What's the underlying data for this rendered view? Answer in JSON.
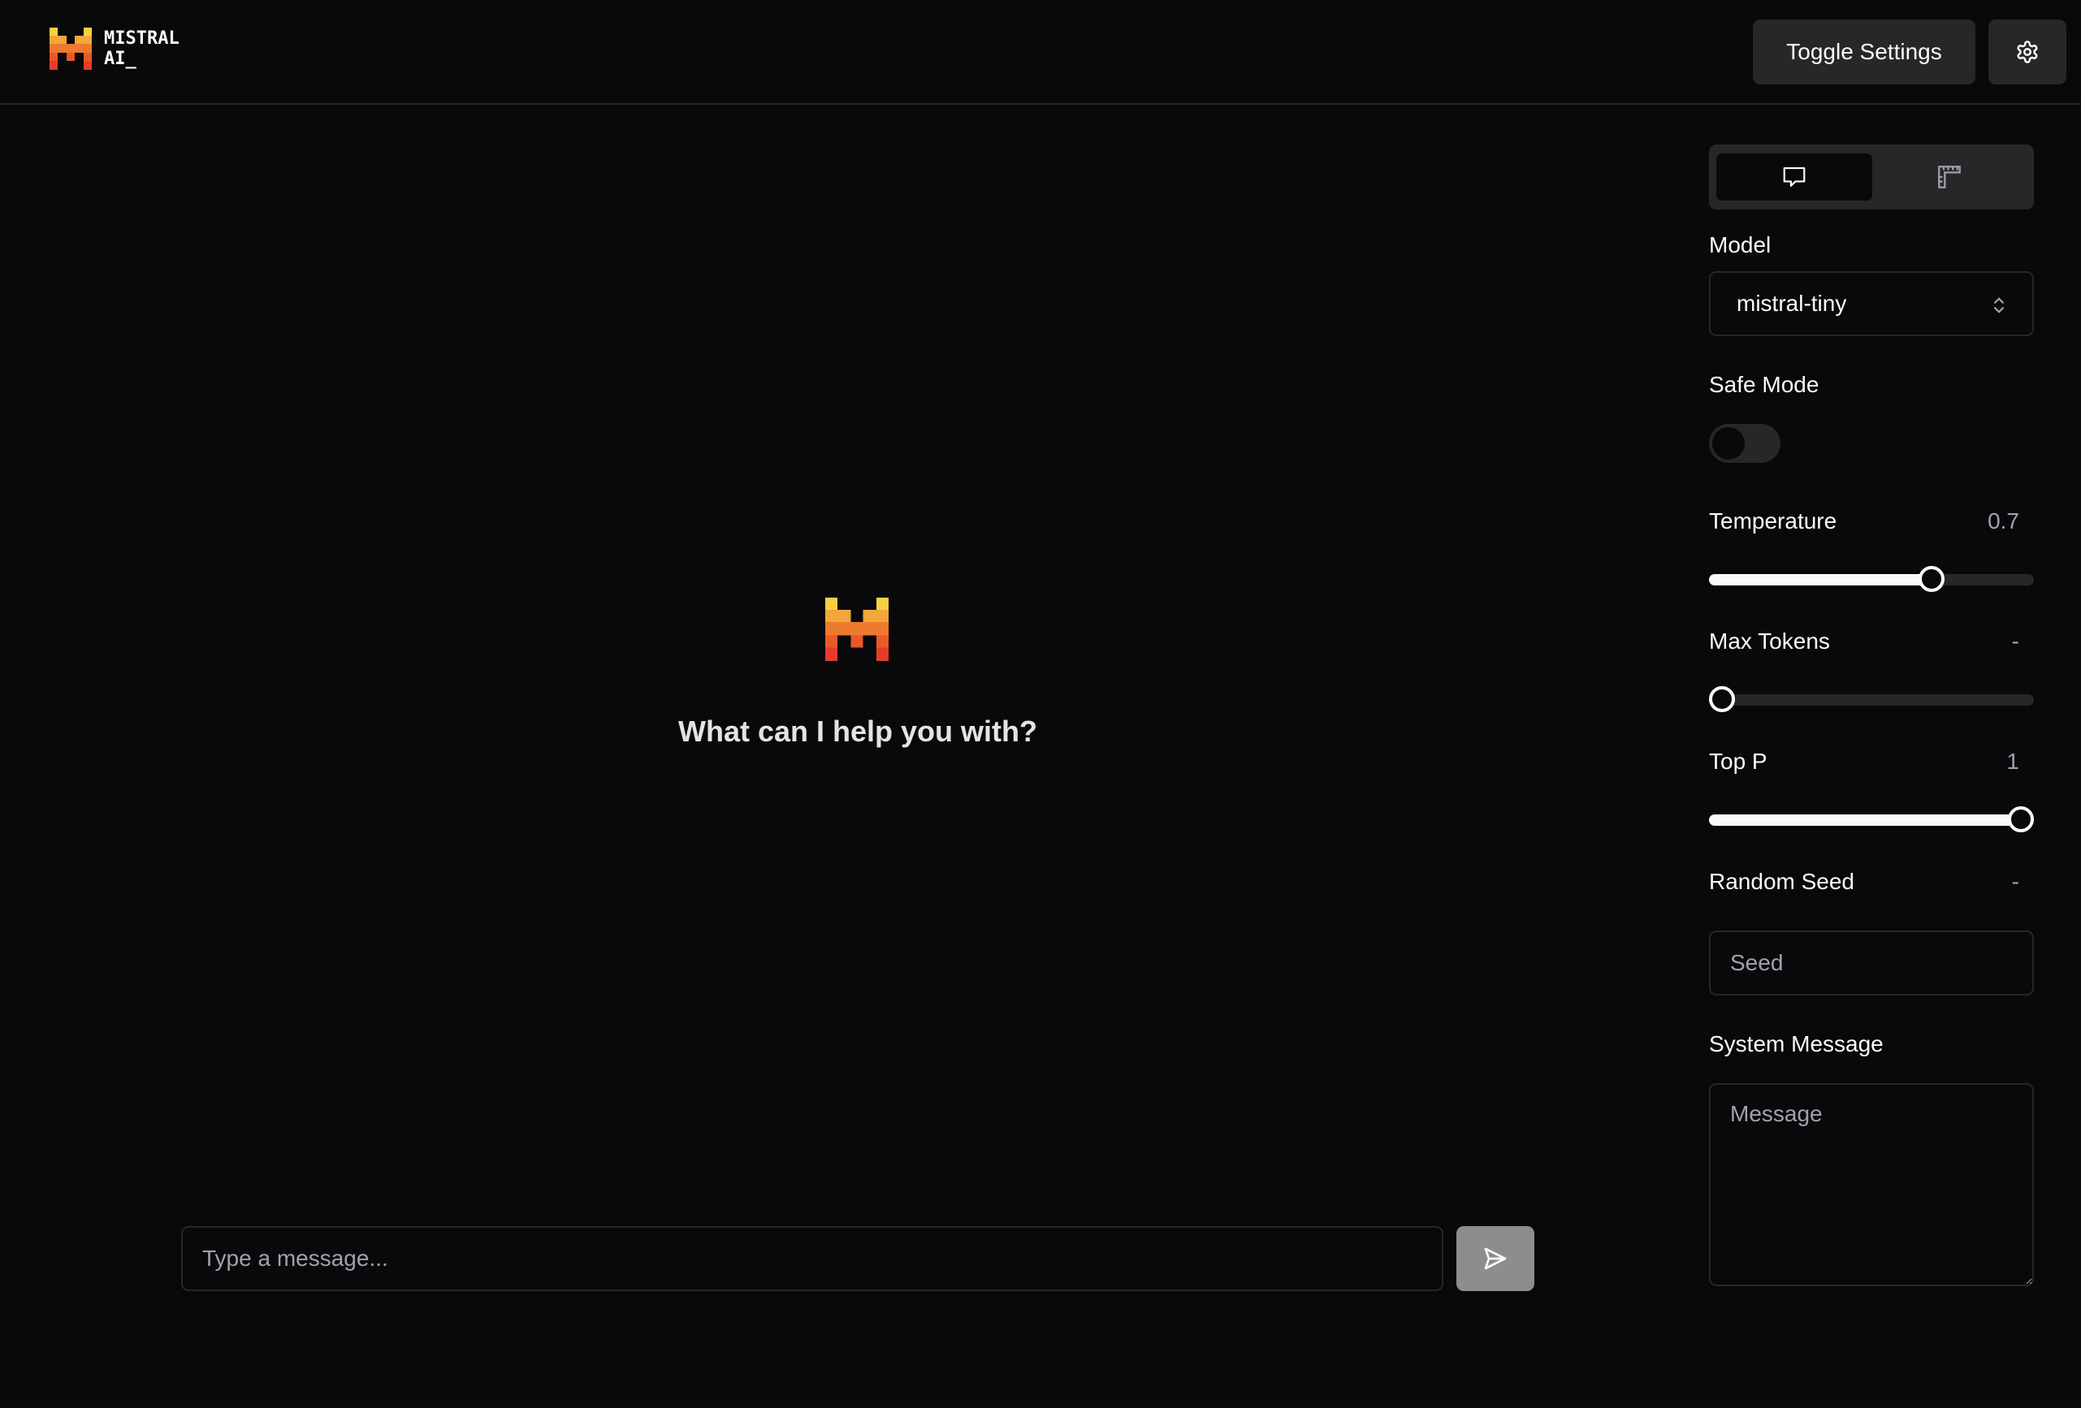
{
  "header": {
    "logo_line1": "MISTRAL",
    "logo_line2": "AI_",
    "toggle_settings_label": "Toggle Settings",
    "settings_icon": "gear-icon"
  },
  "main": {
    "greeting": "What can I help you with?",
    "message_placeholder": "Type a message...",
    "send_icon": "send-icon"
  },
  "sidebar": {
    "tabs": [
      {
        "icon": "chat-bubble-icon",
        "active": true
      },
      {
        "icon": "ruler-icon",
        "active": false
      }
    ],
    "model": {
      "label": "Model",
      "selected": "mistral-tiny"
    },
    "safe_mode": {
      "label": "Safe Mode",
      "enabled": false
    },
    "temperature": {
      "label": "Temperature",
      "value": "0.7",
      "fraction": 0.7
    },
    "max_tokens": {
      "label": "Max Tokens",
      "value": "-",
      "fraction": 0
    },
    "top_p": {
      "label": "Top P",
      "value": "1",
      "fraction": 1
    },
    "random_seed": {
      "label": "Random Seed",
      "value": "-",
      "placeholder": "Seed"
    },
    "system_message": {
      "label": "System Message",
      "placeholder": "Message"
    }
  },
  "colors": {
    "background": "#09090b",
    "surface": "#27272a",
    "text": "#fafafa",
    "muted": "#a1a1aa",
    "logo_yellow": "#f7d046",
    "logo_orange": "#f2a73b",
    "logo_red": "#e53e26"
  }
}
